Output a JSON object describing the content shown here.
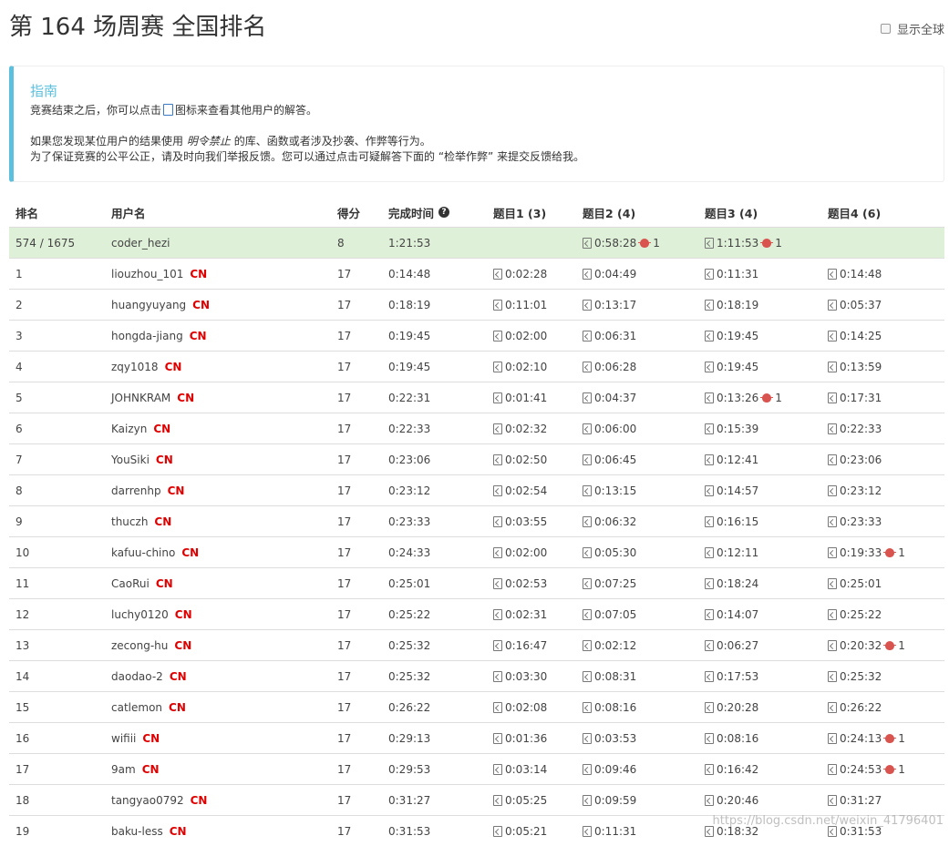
{
  "page": {
    "title": "第 164 场周赛 全国排名",
    "show_global_label": "显示全球"
  },
  "guide": {
    "title": "指南",
    "line1_before": "竞赛结束之后，你可以点击",
    "line1_after": "图标来查看其他用户的解答。",
    "line2_before": "如果您发现某位用户的结果使用",
    "line2_em": "明令禁止",
    "line2_after": "的库、函数或者涉及抄袭、作弊等行为。",
    "line3": "为了保证竞赛的公平公正，请及时向我们举报反馈。您可以通过点击可疑解答下面的 “检举作弊” 来提交反馈给我。"
  },
  "table": {
    "headers": {
      "rank": "排名",
      "user": "用户名",
      "score": "得分",
      "time": "完成时间",
      "q1": "题目1 (3)",
      "q2": "题目2 (4)",
      "q3": "题目3 (4)",
      "q4": "题目4 (6)"
    },
    "my_row": {
      "rank": "574 / 1675",
      "user": "coder_hezi",
      "score": "8",
      "time": "1:21:53",
      "q1": "",
      "q2": "0:58:28",
      "q2_bug": "1",
      "q3": "1:11:53",
      "q3_bug": "1",
      "q4": ""
    },
    "rows": [
      {
        "rank": "1",
        "user": "liouzhou_101",
        "region": "CN",
        "score": "17",
        "time": "0:14:48",
        "q1": "0:02:28",
        "q2": "0:04:49",
        "q3": "0:11:31",
        "q4": "0:14:48"
      },
      {
        "rank": "2",
        "user": "huangyuyang",
        "region": "CN",
        "score": "17",
        "time": "0:18:19",
        "q1": "0:11:01",
        "q2": "0:13:17",
        "q3": "0:18:19",
        "q4": "0:05:37"
      },
      {
        "rank": "3",
        "user": "hongda-jiang",
        "region": "CN",
        "score": "17",
        "time": "0:19:45",
        "q1": "0:02:00",
        "q2": "0:06:31",
        "q3": "0:19:45",
        "q4": "0:14:25"
      },
      {
        "rank": "4",
        "user": "zqy1018",
        "region": "CN",
        "score": "17",
        "time": "0:19:45",
        "q1": "0:02:10",
        "q2": "0:06:28",
        "q3": "0:19:45",
        "q4": "0:13:59"
      },
      {
        "rank": "5",
        "user": "JOHNKRAM",
        "region": "CN",
        "score": "17",
        "time": "0:22:31",
        "q1": "0:01:41",
        "q2": "0:04:37",
        "q3": "0:13:26",
        "q3_bug": "1",
        "q4": "0:17:31"
      },
      {
        "rank": "6",
        "user": "Kaizyn",
        "region": "CN",
        "score": "17",
        "time": "0:22:33",
        "q1": "0:02:32",
        "q2": "0:06:00",
        "q3": "0:15:39",
        "q4": "0:22:33"
      },
      {
        "rank": "7",
        "user": "YouSiki",
        "region": "CN",
        "score": "17",
        "time": "0:23:06",
        "q1": "0:02:50",
        "q2": "0:06:45",
        "q3": "0:12:41",
        "q4": "0:23:06"
      },
      {
        "rank": "8",
        "user": "darrenhp",
        "region": "CN",
        "score": "17",
        "time": "0:23:12",
        "q1": "0:02:54",
        "q2": "0:13:15",
        "q3": "0:14:57",
        "q4": "0:23:12"
      },
      {
        "rank": "9",
        "user": "thuczh",
        "region": "CN",
        "score": "17",
        "time": "0:23:33",
        "q1": "0:03:55",
        "q2": "0:06:32",
        "q3": "0:16:15",
        "q4": "0:23:33"
      },
      {
        "rank": "10",
        "user": "kafuu-chino",
        "region": "CN",
        "score": "17",
        "time": "0:24:33",
        "q1": "0:02:00",
        "q2": "0:05:30",
        "q3": "0:12:11",
        "q4": "0:19:33",
        "q4_bug": "1"
      },
      {
        "rank": "11",
        "user": "CaoRui",
        "region": "CN",
        "score": "17",
        "time": "0:25:01",
        "q1": "0:02:53",
        "q2": "0:07:25",
        "q3": "0:18:24",
        "q4": "0:25:01"
      },
      {
        "rank": "12",
        "user": "luchy0120",
        "region": "CN",
        "score": "17",
        "time": "0:25:22",
        "q1": "0:02:31",
        "q2": "0:07:05",
        "q3": "0:14:07",
        "q4": "0:25:22"
      },
      {
        "rank": "13",
        "user": "zecong-hu",
        "region": "CN",
        "score": "17",
        "time": "0:25:32",
        "q1": "0:16:47",
        "q2": "0:02:12",
        "q3": "0:06:27",
        "q4": "0:20:32",
        "q4_bug": "1"
      },
      {
        "rank": "14",
        "user": "daodao-2",
        "region": "CN",
        "score": "17",
        "time": "0:25:32",
        "q1": "0:03:30",
        "q2": "0:08:31",
        "q3": "0:17:53",
        "q4": "0:25:32"
      },
      {
        "rank": "15",
        "user": "catlemon",
        "region": "CN",
        "score": "17",
        "time": "0:26:22",
        "q1": "0:02:08",
        "q2": "0:08:16",
        "q3": "0:20:28",
        "q4": "0:26:22"
      },
      {
        "rank": "16",
        "user": "wifiii",
        "region": "CN",
        "score": "17",
        "time": "0:29:13",
        "q1": "0:01:36",
        "q2": "0:03:53",
        "q3": "0:08:16",
        "q4": "0:24:13",
        "q4_bug": "1"
      },
      {
        "rank": "17",
        "user": "9am",
        "region": "CN",
        "score": "17",
        "time": "0:29:53",
        "q1": "0:03:14",
        "q2": "0:09:46",
        "q3": "0:16:42",
        "q4": "0:24:53",
        "q4_bug": "1"
      },
      {
        "rank": "18",
        "user": "tangyao0792",
        "region": "CN",
        "score": "17",
        "time": "0:31:27",
        "q1": "0:05:25",
        "q2": "0:09:59",
        "q3": "0:20:46",
        "q4": "0:31:27"
      },
      {
        "rank": "19",
        "user": "baku-less",
        "region": "CN",
        "score": "17",
        "time": "0:31:53",
        "q1": "0:05:21",
        "q2": "0:11:31",
        "q3": "0:18:32",
        "q4": "0:31:53"
      }
    ]
  },
  "watermark": "https://blog.csdn.net/weixin_41796401"
}
